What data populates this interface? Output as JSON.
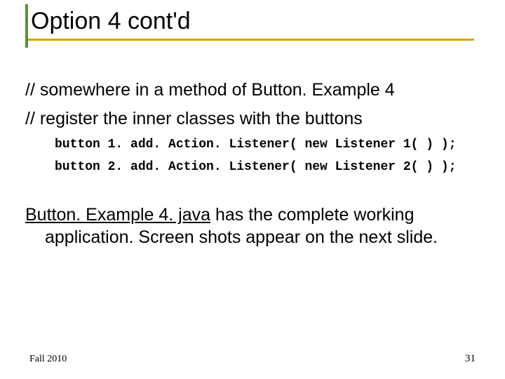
{
  "title": "Option 4 cont'd",
  "comment1": "// somewhere in a method of Button. Example 4",
  "comment2": "// register the inner classes with the buttons",
  "code1": "button 1. add. Action. Listener( new Listener 1( ) );",
  "code2": "button 2. add. Action. Listener( new Listener 2( ) );",
  "link_text": "Button. Example 4. java",
  "link_after": " has the complete working application.  Screen shots appear on the next slide.",
  "footer_left": "Fall 2010",
  "footer_right": "31"
}
